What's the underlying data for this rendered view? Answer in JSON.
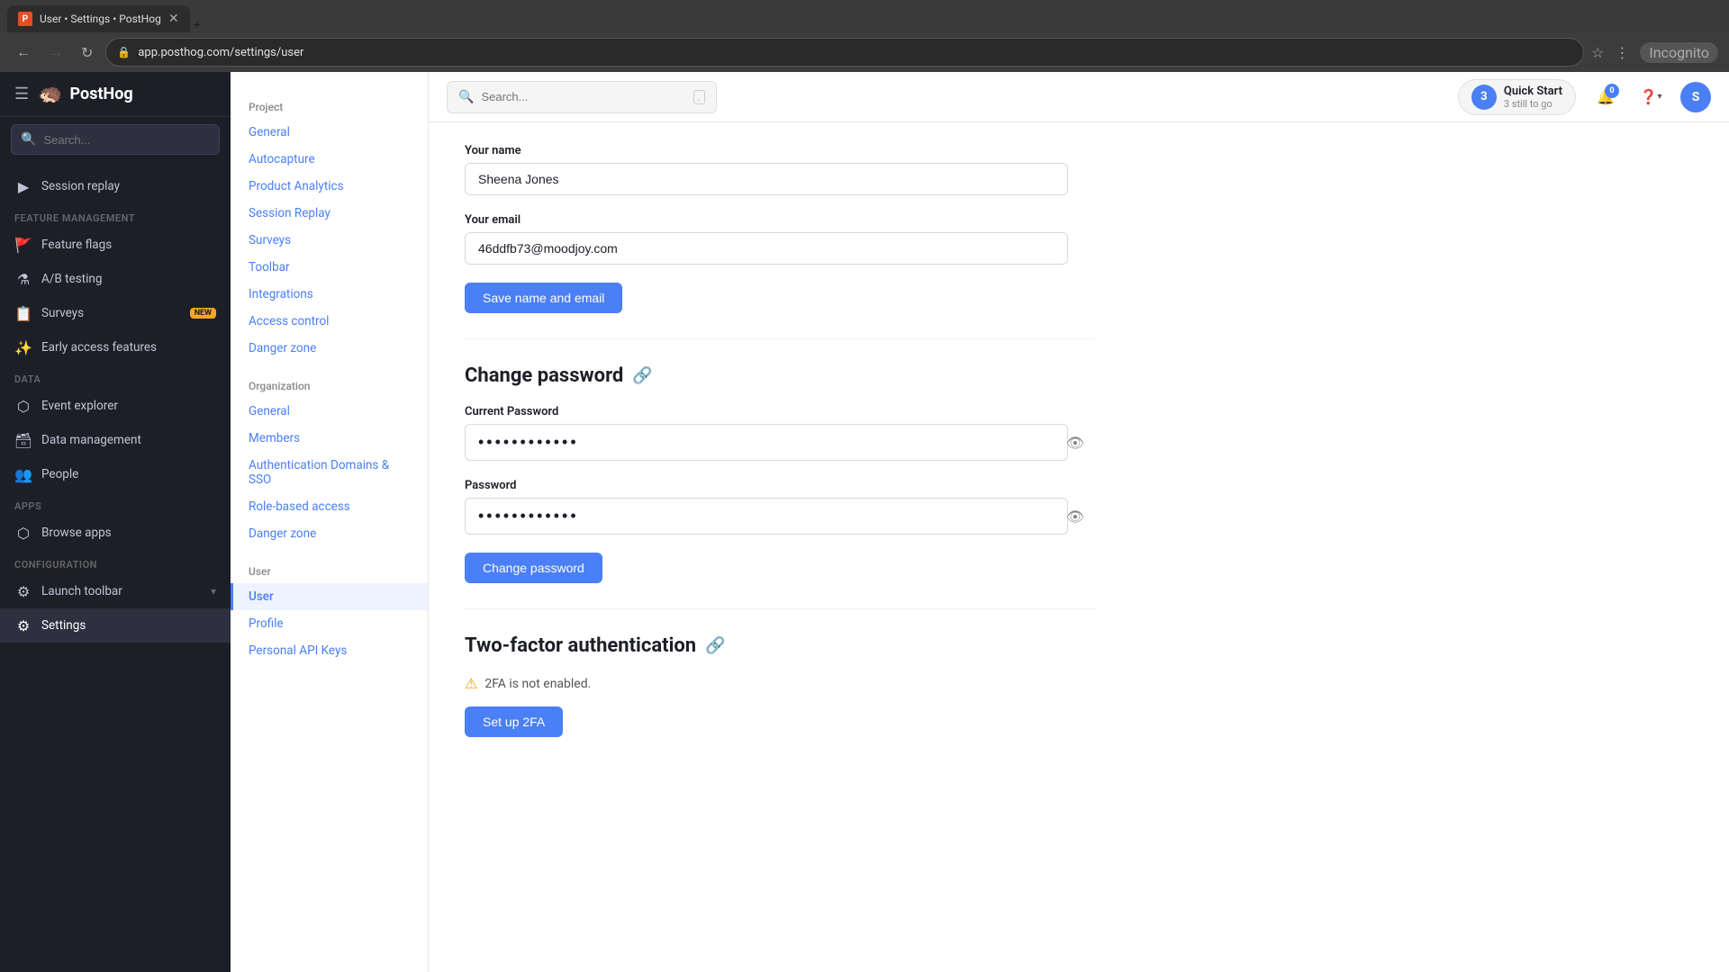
{
  "browser": {
    "tab_title": "User • Settings • PostHog",
    "url": "app.posthog.com/settings/user",
    "new_tab_label": "+",
    "incognito_label": "Incognito"
  },
  "topbar": {
    "search_placeholder": "Search...",
    "search_shortcut": ".",
    "quickstart_number": "3",
    "quickstart_title": "Quick Start",
    "quickstart_sub": "3 still to go",
    "notification_count": "0"
  },
  "sidebar": {
    "logo_text": "PostHog",
    "items": [
      {
        "id": "session-replay",
        "label": "Session replay",
        "icon": "▶"
      },
      {
        "id": "feature-flags",
        "label": "Feature flags",
        "icon": "🚩",
        "section": "FEATURE MANAGEMENT"
      },
      {
        "id": "ab-testing",
        "label": "A/B testing",
        "icon": "⚗"
      },
      {
        "id": "surveys",
        "label": "Surveys",
        "icon": "📋",
        "badge": "NEW"
      },
      {
        "id": "early-access",
        "label": "Early access features",
        "icon": "✨"
      },
      {
        "id": "event-explorer",
        "label": "Event explorer",
        "icon": "🔍",
        "section": "DATA"
      },
      {
        "id": "data-management",
        "label": "Data management",
        "icon": "🗃"
      },
      {
        "id": "people",
        "label": "People",
        "icon": "👥"
      },
      {
        "id": "browse-apps",
        "label": "Browse apps",
        "icon": "⬡",
        "section": "APPS"
      },
      {
        "id": "launch-toolbar",
        "label": "Launch toolbar",
        "icon": "⚙",
        "section": "CONFIGURATION",
        "chevron": "▾"
      },
      {
        "id": "settings",
        "label": "Settings",
        "icon": "⚙",
        "active": true
      }
    ]
  },
  "settings_nav": {
    "project_label": "Project",
    "project_items": [
      "General",
      "Autocapture",
      "Product Analytics",
      "Session Replay",
      "Surveys",
      "Toolbar",
      "Integrations",
      "Access control",
      "Danger zone"
    ],
    "org_label": "Organization",
    "org_items": [
      "General",
      "Members",
      "Authentication Domains & SSO",
      "Role-based access",
      "Danger zone"
    ],
    "user_label": "User",
    "user_items": [
      {
        "label": "Profile",
        "active": false
      },
      {
        "label": "Personal API Keys",
        "active": false
      }
    ],
    "user_section_label": "User",
    "active_item": "User"
  },
  "main": {
    "your_name_label": "Your name",
    "your_name_value": "Sheena Jones",
    "your_email_label": "Your email",
    "your_email_value": "46ddfb73@moodjoy.com",
    "save_name_email_btn": "Save name and email",
    "change_password_title": "Change password",
    "current_password_label": "Current Password",
    "current_password_value": "••••••••••••",
    "password_label": "Password",
    "password_value": "••••••••••••",
    "change_password_btn": "Change password",
    "two_factor_title": "Two-factor authentication",
    "two_factor_warning": "2FA is not enabled.",
    "setup_2fa_btn": "Set up 2FA",
    "profile_tab": "Profile",
    "personal_api_keys_tab": "Personal API Keys"
  }
}
